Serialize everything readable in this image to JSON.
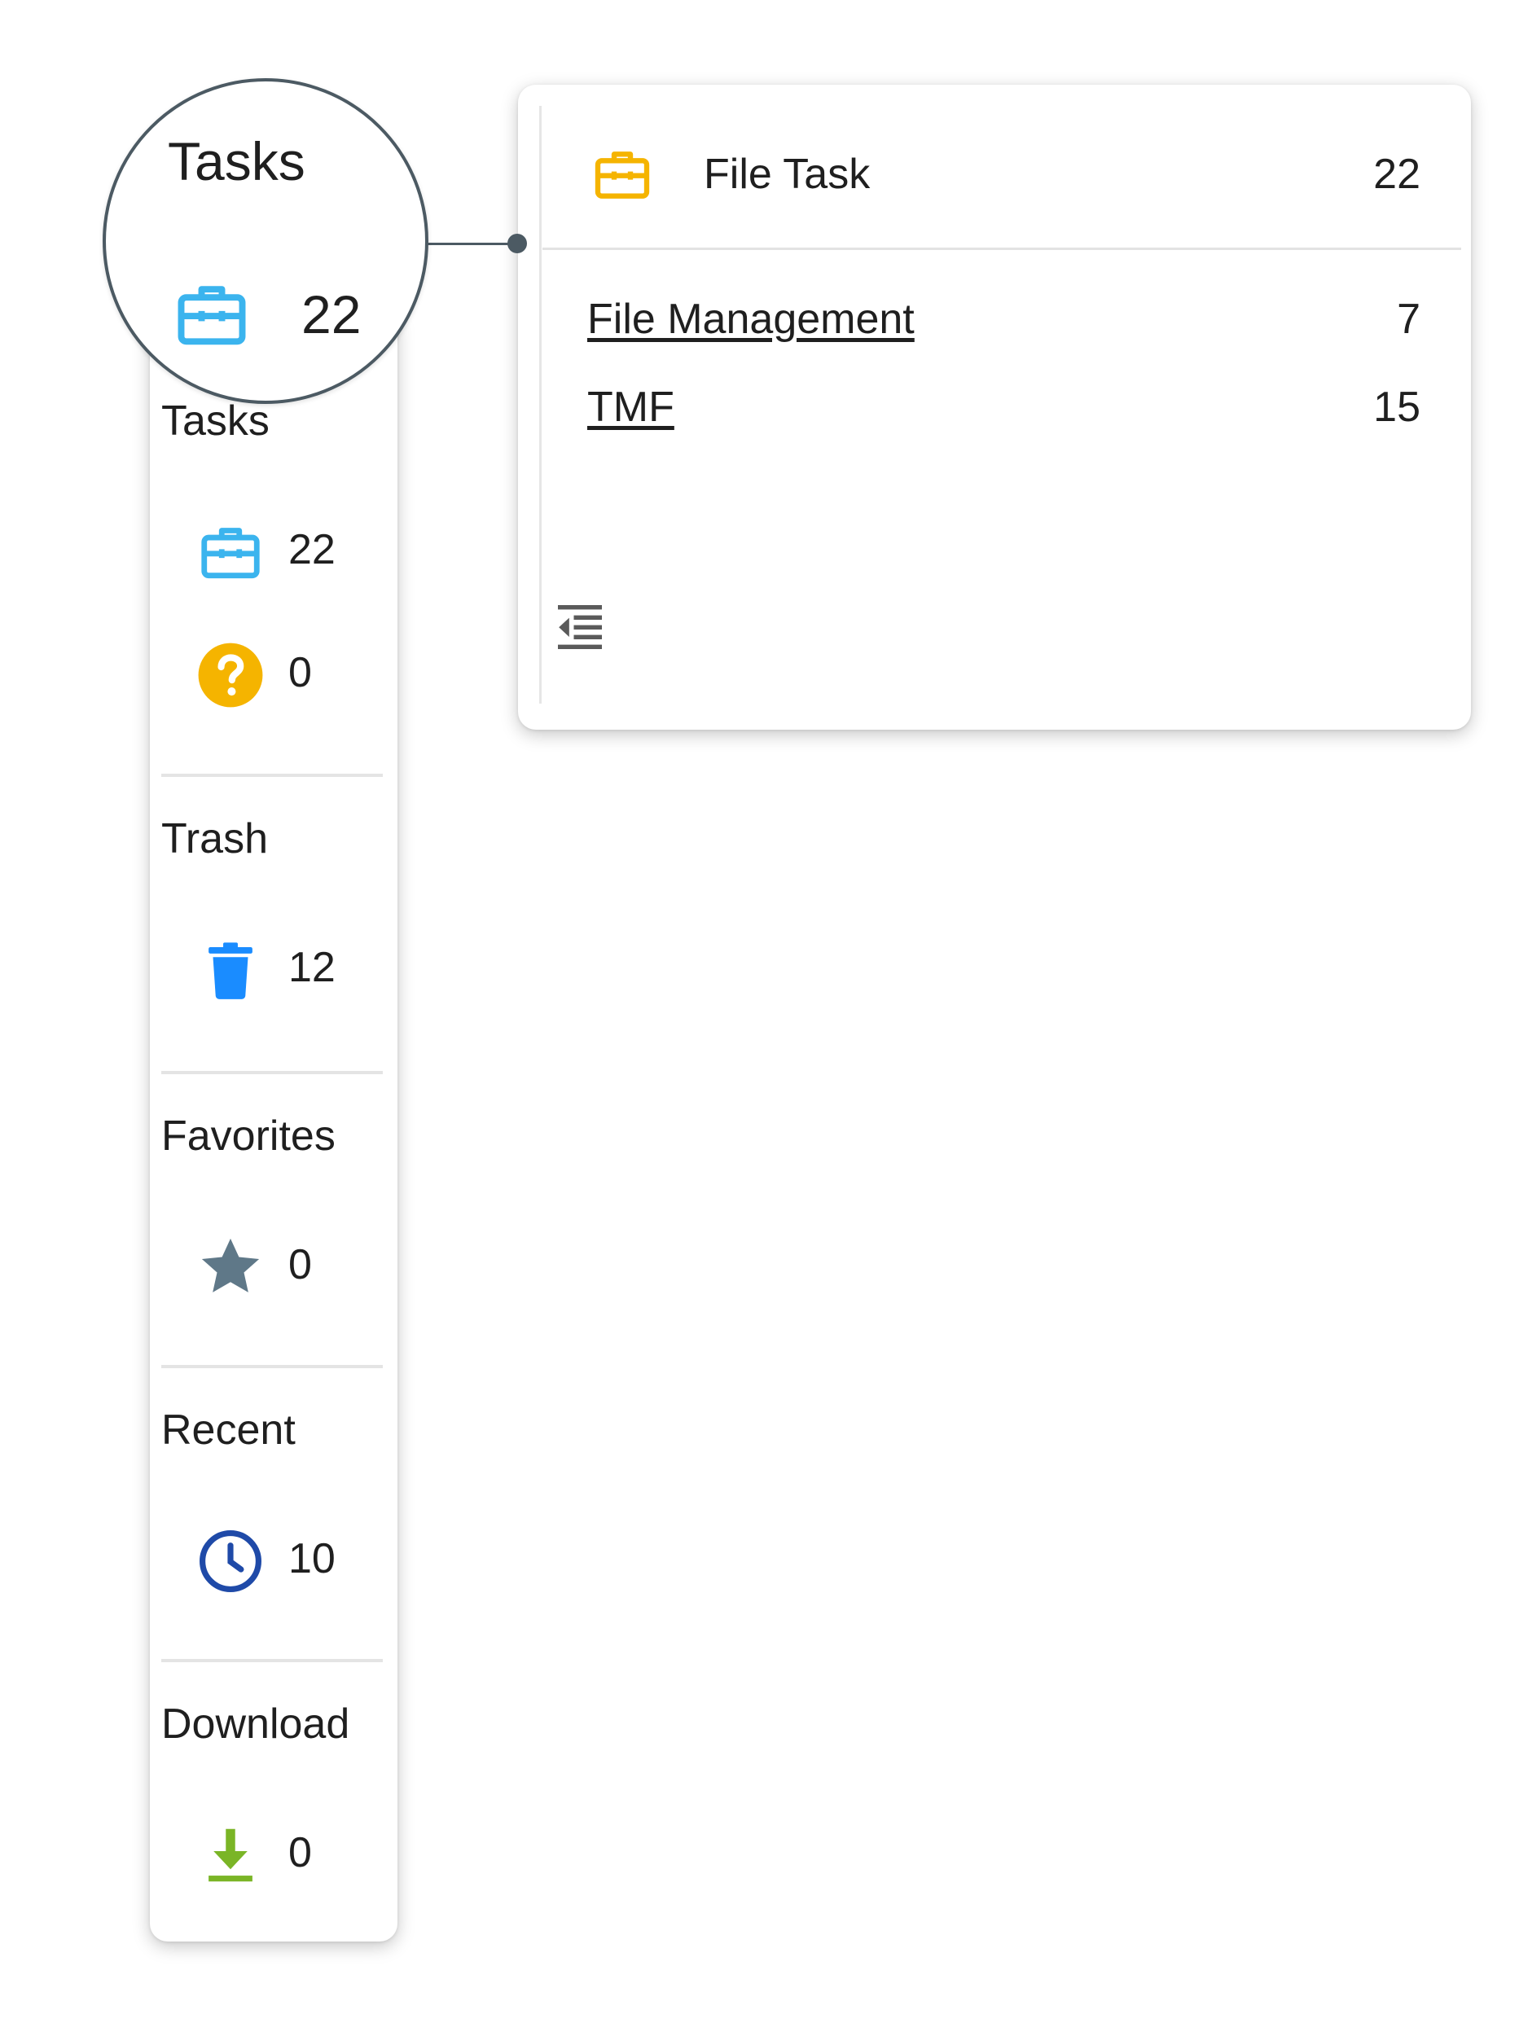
{
  "magnifier": {
    "title": "Tasks",
    "count": "22",
    "icon": "briefcase-icon"
  },
  "sidebar": {
    "sections": [
      {
        "title": "Tasks",
        "items": [
          {
            "icon": "briefcase-icon",
            "color": "#3bb4ee",
            "count": "22"
          },
          {
            "icon": "question-icon",
            "color": "#f5b400",
            "count": "0"
          }
        ]
      },
      {
        "title": "Trash",
        "items": [
          {
            "icon": "trash-icon",
            "color": "#1a8cff",
            "count": "12"
          }
        ]
      },
      {
        "title": "Favorites",
        "items": [
          {
            "icon": "star-icon",
            "color": "#5f7888",
            "count": "0"
          }
        ]
      },
      {
        "title": "Recent",
        "items": [
          {
            "icon": "clock-icon",
            "color": "#1f4aa8",
            "count": "10"
          }
        ]
      },
      {
        "title": "Download",
        "items": [
          {
            "icon": "download-icon",
            "color": "#7ab526",
            "count": "0"
          }
        ]
      }
    ]
  },
  "popup": {
    "header": {
      "icon": "briefcase-icon",
      "color": "#f5b400",
      "label": "File Task",
      "count": "22"
    },
    "rows": [
      {
        "label": "File Management",
        "count": "7"
      },
      {
        "label": "TMF",
        "count": "15"
      }
    ],
    "collapse_icon": "collapse-list-icon"
  }
}
